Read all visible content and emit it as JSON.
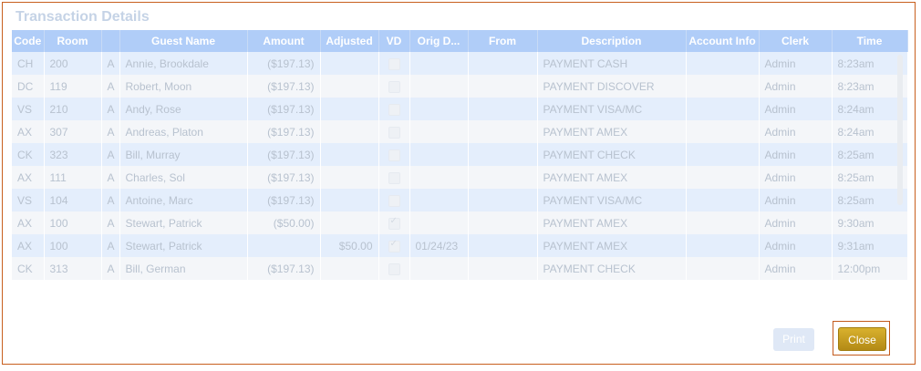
{
  "dialog": {
    "title": "Transaction Details",
    "columns": [
      "Code",
      "Room",
      "",
      "Guest Name",
      "Amount",
      "Adjusted",
      "VD",
      "Orig D...",
      "From",
      "Description",
      "Account Info",
      "Clerk",
      "Time"
    ],
    "rows": [
      {
        "code": "CH",
        "room": "200",
        "type": "A",
        "guest": "Annie, Brookdale",
        "amount": "($197.13)",
        "adjusted": "",
        "vd": false,
        "orig": "",
        "from": "",
        "description": "PAYMENT CASH",
        "account": "",
        "clerk": "Admin",
        "time": "8:23am"
      },
      {
        "code": "DC",
        "room": "119",
        "type": "A",
        "guest": "Robert, Moon",
        "amount": "($197.13)",
        "adjusted": "",
        "vd": false,
        "orig": "",
        "from": "",
        "description": "PAYMENT DISCOVER",
        "account": "",
        "clerk": "Admin",
        "time": "8:23am"
      },
      {
        "code": "VS",
        "room": "210",
        "type": "A",
        "guest": "Andy, Rose",
        "amount": "($197.13)",
        "adjusted": "",
        "vd": false,
        "orig": "",
        "from": "",
        "description": "PAYMENT VISA/MC",
        "account": "",
        "clerk": "Admin",
        "time": "8:24am"
      },
      {
        "code": "AX",
        "room": "307",
        "type": "A",
        "guest": "Andreas, Platon",
        "amount": "($197.13)",
        "adjusted": "",
        "vd": false,
        "orig": "",
        "from": "",
        "description": "PAYMENT AMEX",
        "account": "",
        "clerk": "Admin",
        "time": "8:24am"
      },
      {
        "code": "CK",
        "room": "323",
        "type": "A",
        "guest": "Bill, Murray",
        "amount": "($197.13)",
        "adjusted": "",
        "vd": false,
        "orig": "",
        "from": "",
        "description": "PAYMENT CHECK",
        "account": "",
        "clerk": "Admin",
        "time": "8:25am"
      },
      {
        "code": "AX",
        "room": "111",
        "type": "A",
        "guest": "Charles, Sol",
        "amount": "($197.13)",
        "adjusted": "",
        "vd": false,
        "orig": "",
        "from": "",
        "description": "PAYMENT AMEX",
        "account": "",
        "clerk": "Admin",
        "time": "8:25am"
      },
      {
        "code": "VS",
        "room": "104",
        "type": "A",
        "guest": "Antoine, Marc",
        "amount": "($197.13)",
        "adjusted": "",
        "vd": false,
        "orig": "",
        "from": "",
        "description": "PAYMENT VISA/MC",
        "account": "",
        "clerk": "Admin",
        "time": "8:25am"
      },
      {
        "code": "AX",
        "room": "100",
        "type": "A",
        "guest": "Stewart, Patrick",
        "amount": "($50.00)",
        "adjusted": "",
        "vd": true,
        "orig": "",
        "from": "",
        "description": "PAYMENT AMEX",
        "account": "",
        "clerk": "Admin",
        "time": "9:30am"
      },
      {
        "code": "AX",
        "room": "100",
        "type": "A",
        "guest": "Stewart, Patrick",
        "amount": "",
        "adjusted": "$50.00",
        "vd": true,
        "orig": "01/24/23",
        "from": "",
        "description": "PAYMENT AMEX",
        "account": "",
        "clerk": "Admin",
        "time": "9:31am"
      },
      {
        "code": "CK",
        "room": "313",
        "type": "A",
        "guest": "Bill, German",
        "amount": "($197.13)",
        "adjusted": "",
        "vd": false,
        "orig": "",
        "from": "",
        "description": "PAYMENT CHECK",
        "account": "",
        "clerk": "Admin",
        "time": "12:00pm"
      }
    ]
  },
  "buttons": {
    "print": "Print",
    "close": "Close"
  },
  "colors": {
    "header": "#b0cdf8",
    "accent_close": "#c9a023",
    "highlight_border": "#c35a1c"
  }
}
